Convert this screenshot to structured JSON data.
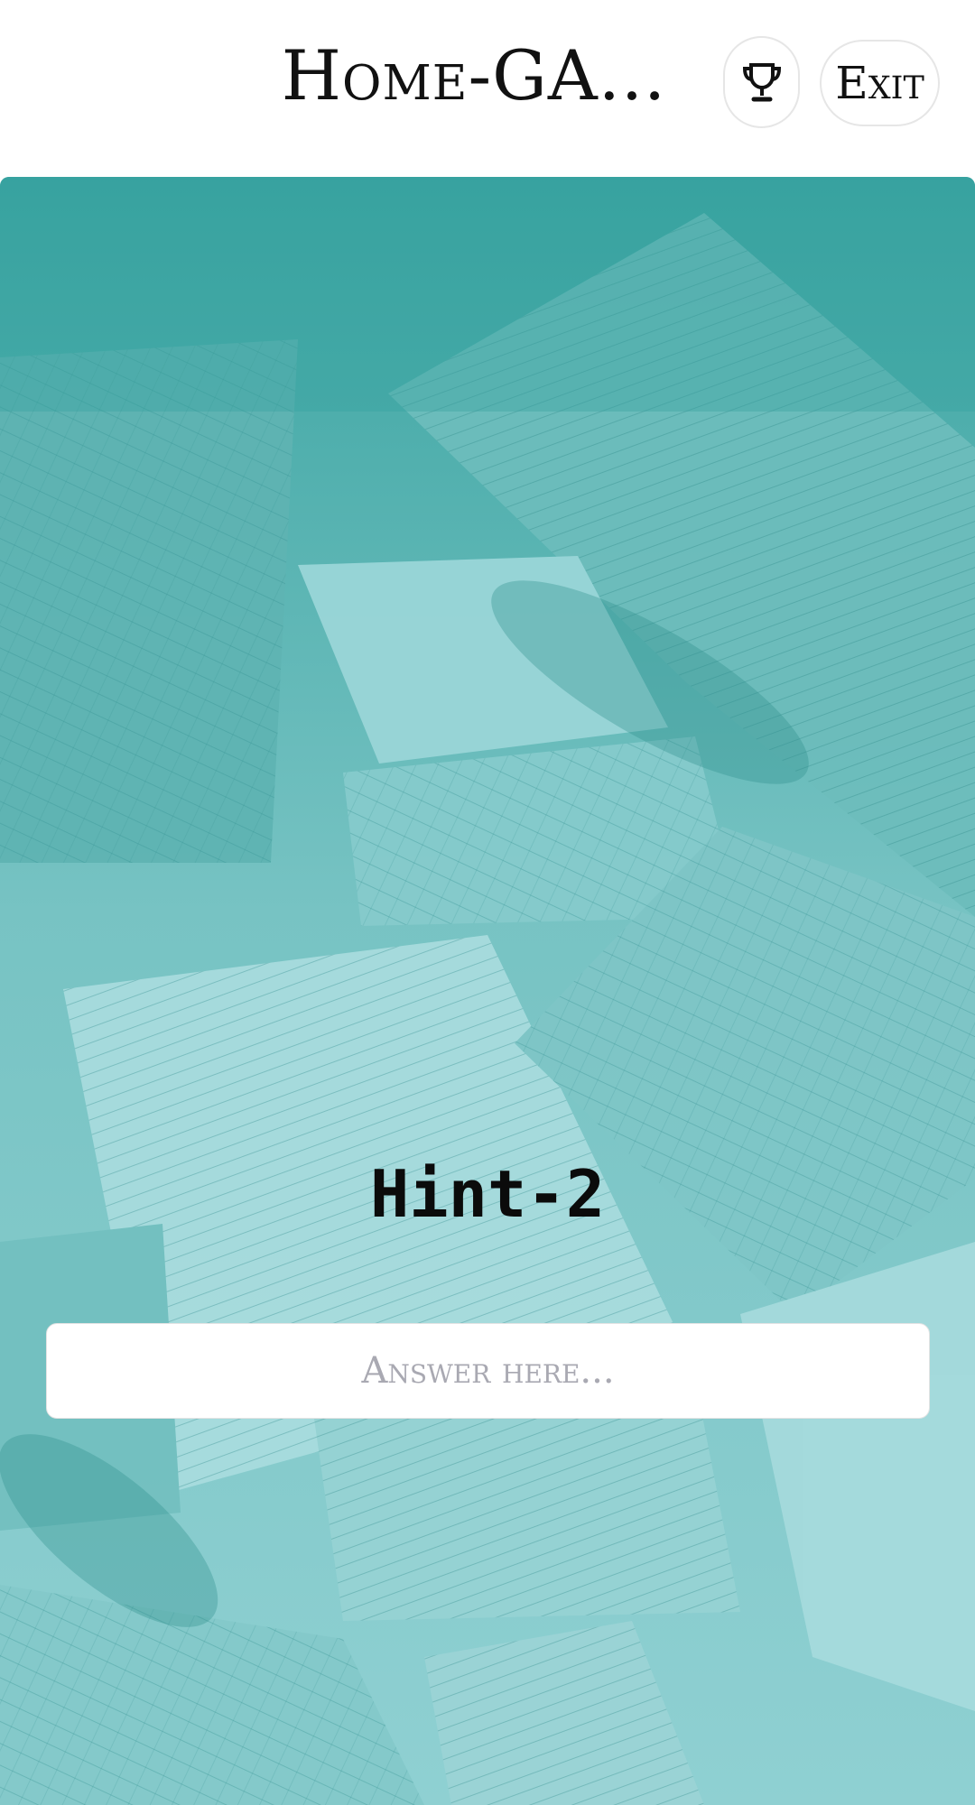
{
  "header": {
    "title": "Home-GA...",
    "trophy_icon": "trophy-icon",
    "exit_label": "Exit"
  },
  "main": {
    "hint_title": "Hint-2",
    "answer": {
      "placeholder": "Answer here...",
      "value": ""
    },
    "background": "teal-tinted scattered maps photo"
  },
  "colors": {
    "accent_teal": "#3fa7a5",
    "text_dark": "#111111",
    "placeholder": "#a9a9b2"
  }
}
